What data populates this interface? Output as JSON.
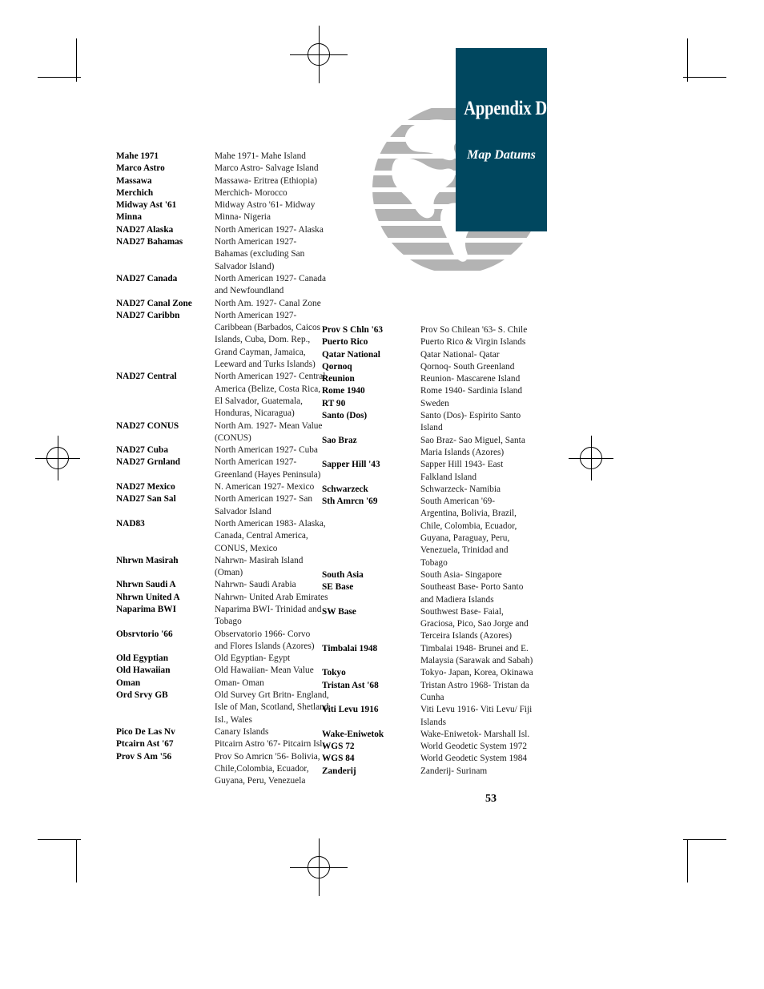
{
  "header": {
    "appendix_title": "Appendix D",
    "appendix_subtitle": "Map Datums",
    "box_color": "#00475f",
    "globe_color": "#b3b3b3",
    "globe_icon": "globe-icon"
  },
  "page_number": "53",
  "printer_marks": {
    "corner_crop_icon": "crop-mark-icon",
    "registration_icon": "registration-target-icon"
  },
  "columns": {
    "left": [
      {
        "term": "Mahe 1971",
        "definition": [
          "Mahe 1971- Mahe Island"
        ]
      },
      {
        "term": "Marco Astro",
        "definition": [
          "Marco Astro- Salvage Island"
        ]
      },
      {
        "term": "Massawa",
        "definition": [
          "Massawa- Eritrea (Ethiopia)"
        ]
      },
      {
        "term": "Merchich",
        "definition": [
          "Merchich- Morocco"
        ]
      },
      {
        "term": "Midway Ast '61",
        "definition": [
          "Midway Astro '61- Midway"
        ]
      },
      {
        "term": "Minna",
        "definition": [
          "Minna- Nigeria"
        ]
      },
      {
        "term": "NAD27 Alaska",
        "definition": [
          "North American 1927- Alaska"
        ]
      },
      {
        "term": "NAD27 Bahamas",
        "definition": [
          "North American 1927-",
          "Bahamas (excluding San",
          "Salvador Island)"
        ]
      },
      {
        "term": "NAD27 Canada",
        "definition": [
          "North American 1927- Canada",
          "and Newfoundland"
        ]
      },
      {
        "term": "NAD27 Canal Zone",
        "definition": [
          "North Am. 1927- Canal Zone"
        ]
      },
      {
        "term": "NAD27 Caribbn",
        "definition": [
          "North American 1927-",
          "Caribbean (Barbados, Caicos",
          "Islands, Cuba, Dom. Rep.,",
          "Grand Cayman, Jamaica,",
          "Leeward and Turks Islands)"
        ]
      },
      {
        "term": "NAD27 Central",
        "definition": [
          "North American 1927- Central",
          "America (Belize, Costa Rica,",
          "El Salvador, Guatemala,",
          "Honduras, Nicaragua)"
        ]
      },
      {
        "term": "NAD27 CONUS",
        "definition": [
          "North Am. 1927- Mean Value",
          "(CONUS)"
        ]
      },
      {
        "term": "NAD27 Cuba",
        "definition": [
          "North American 1927- Cuba"
        ]
      },
      {
        "term": "NAD27 Grnland",
        "definition": [
          "North American 1927-",
          "Greenland (Hayes Peninsula)"
        ]
      },
      {
        "term": "NAD27 Mexico",
        "definition": [
          "N. American 1927- Mexico"
        ]
      },
      {
        "term": "NAD27 San Sal",
        "definition": [
          "North American 1927- San",
          "Salvador Island"
        ]
      },
      {
        "term": "NAD83",
        "definition": [
          "North American 1983- Alaska,",
          "Canada, Central America,",
          "CONUS, Mexico"
        ]
      },
      {
        "term": "Nhrwn Masirah",
        "definition": [
          "Nahrwn- Masirah Island",
          "(Oman)"
        ]
      },
      {
        "term": "Nhrwn Saudi A",
        "definition": [
          "Nahrwn- Saudi Arabia"
        ]
      },
      {
        "term": "Nhrwn United A",
        "definition": [
          "Nahrwn- United Arab Emirates"
        ]
      },
      {
        "term": "Naparima BWI",
        "definition": [
          "Naparima BWI- Trinidad and",
          "Tobago"
        ]
      },
      {
        "term": "Obsrvtorio '66",
        "definition": [
          "Observatorio 1966- Corvo",
          "and Flores Islands (Azores)"
        ]
      },
      {
        "term": "Old Egyptian",
        "definition": [
          "Old Egyptian- Egypt"
        ]
      },
      {
        "term": "Old Hawaiian",
        "definition": [
          "Old Hawaiian- Mean Value"
        ]
      },
      {
        "term": "Oman",
        "definition": [
          "Oman- Oman"
        ]
      },
      {
        "term": "Ord Srvy GB",
        "definition": [
          "Old Survey Grt Britn- England,",
          "Isle of Man, Scotland, Shetland",
          "Isl., Wales"
        ]
      },
      {
        "term": "Pico De Las Nv",
        "definition": [
          "Canary Islands"
        ]
      },
      {
        "term": "Ptcairn Ast '67",
        "definition": [
          "Pitcairn Astro '67- Pitcairn Isl."
        ]
      },
      {
        "term": "Prov S Am '56",
        "definition": [
          "Prov So Amricn '56- Bolivia,",
          "Chile,Colombia, Ecuador,",
          "Guyana, Peru, Venezuela"
        ]
      }
    ],
    "right": [
      {
        "term": "Prov S Chln '63",
        "definition": [
          "Prov So Chilean '63- S. Chile"
        ]
      },
      {
        "term": "Puerto Rico",
        "definition": [
          "Puerto Rico & Virgin Islands"
        ]
      },
      {
        "term": "Qatar National",
        "definition": [
          "Qatar National- Qatar"
        ]
      },
      {
        "term": "Qornoq",
        "definition": [
          "Qornoq- South Greenland"
        ]
      },
      {
        "term": "Reunion",
        "definition": [
          "Reunion- Mascarene Island"
        ]
      },
      {
        "term": "Rome 1940",
        "definition": [
          "Rome 1940- Sardinia Island"
        ]
      },
      {
        "term": "RT 90",
        "definition": [
          "Sweden"
        ]
      },
      {
        "term": "Santo (Dos)",
        "definition": [
          "Santo (Dos)- Espirito Santo",
          "Island"
        ]
      },
      {
        "term": "Sao Braz",
        "definition": [
          "Sao Braz- Sao Miguel, Santa",
          "Maria Islands (Azores)"
        ]
      },
      {
        "term": "Sapper Hill '43",
        "definition": [
          "Sapper Hill 1943- East",
          "Falkland Island"
        ]
      },
      {
        "term": "Schwarzeck",
        "definition": [
          "Schwarzeck- Namibia"
        ]
      },
      {
        "term": "Sth Amrcn '69",
        "definition": [
          "South American '69-",
          "Argentina, Bolivia, Brazil,",
          "Chile, Colombia, Ecuador,",
          "Guyana, Paraguay, Peru,",
          "Venezuela, Trinidad and",
          "Tobago"
        ]
      },
      {
        "term": "South Asia",
        "definition": [
          "South Asia- Singapore"
        ]
      },
      {
        "term": "SE Base",
        "definition": [
          "Southeast Base- Porto Santo",
          "and Madiera Islands"
        ]
      },
      {
        "term": "SW Base",
        "definition": [
          "Southwest Base- Faial,",
          "Graciosa, Pico, Sao Jorge and",
          "Terceira Islands (Azores)"
        ]
      },
      {
        "term": "Timbalai 1948",
        "definition": [
          "Timbalai 1948- Brunei and E.",
          "Malaysia (Sarawak and Sabah)"
        ]
      },
      {
        "term": "Tokyo",
        "definition": [
          "Tokyo- Japan, Korea, Okinawa"
        ]
      },
      {
        "term": "Tristan Ast '68",
        "definition": [
          "Tristan Astro 1968- Tristan da",
          "Cunha"
        ]
      },
      {
        "term": "Viti Levu 1916",
        "definition": [
          "Viti Levu 1916- Viti Levu/ Fiji",
          "Islands"
        ]
      },
      {
        "term": "Wake-Eniwetok",
        "definition": [
          "Wake-Eniwetok- Marshall Isl."
        ]
      },
      {
        "term": "WGS 72",
        "definition": [
          "World Geodetic System 1972"
        ]
      },
      {
        "term": "WGS 84",
        "definition": [
          "World Geodetic System 1984"
        ]
      },
      {
        "term": "Zanderij",
        "definition": [
          "Zanderij- Surinam"
        ]
      }
    ]
  }
}
